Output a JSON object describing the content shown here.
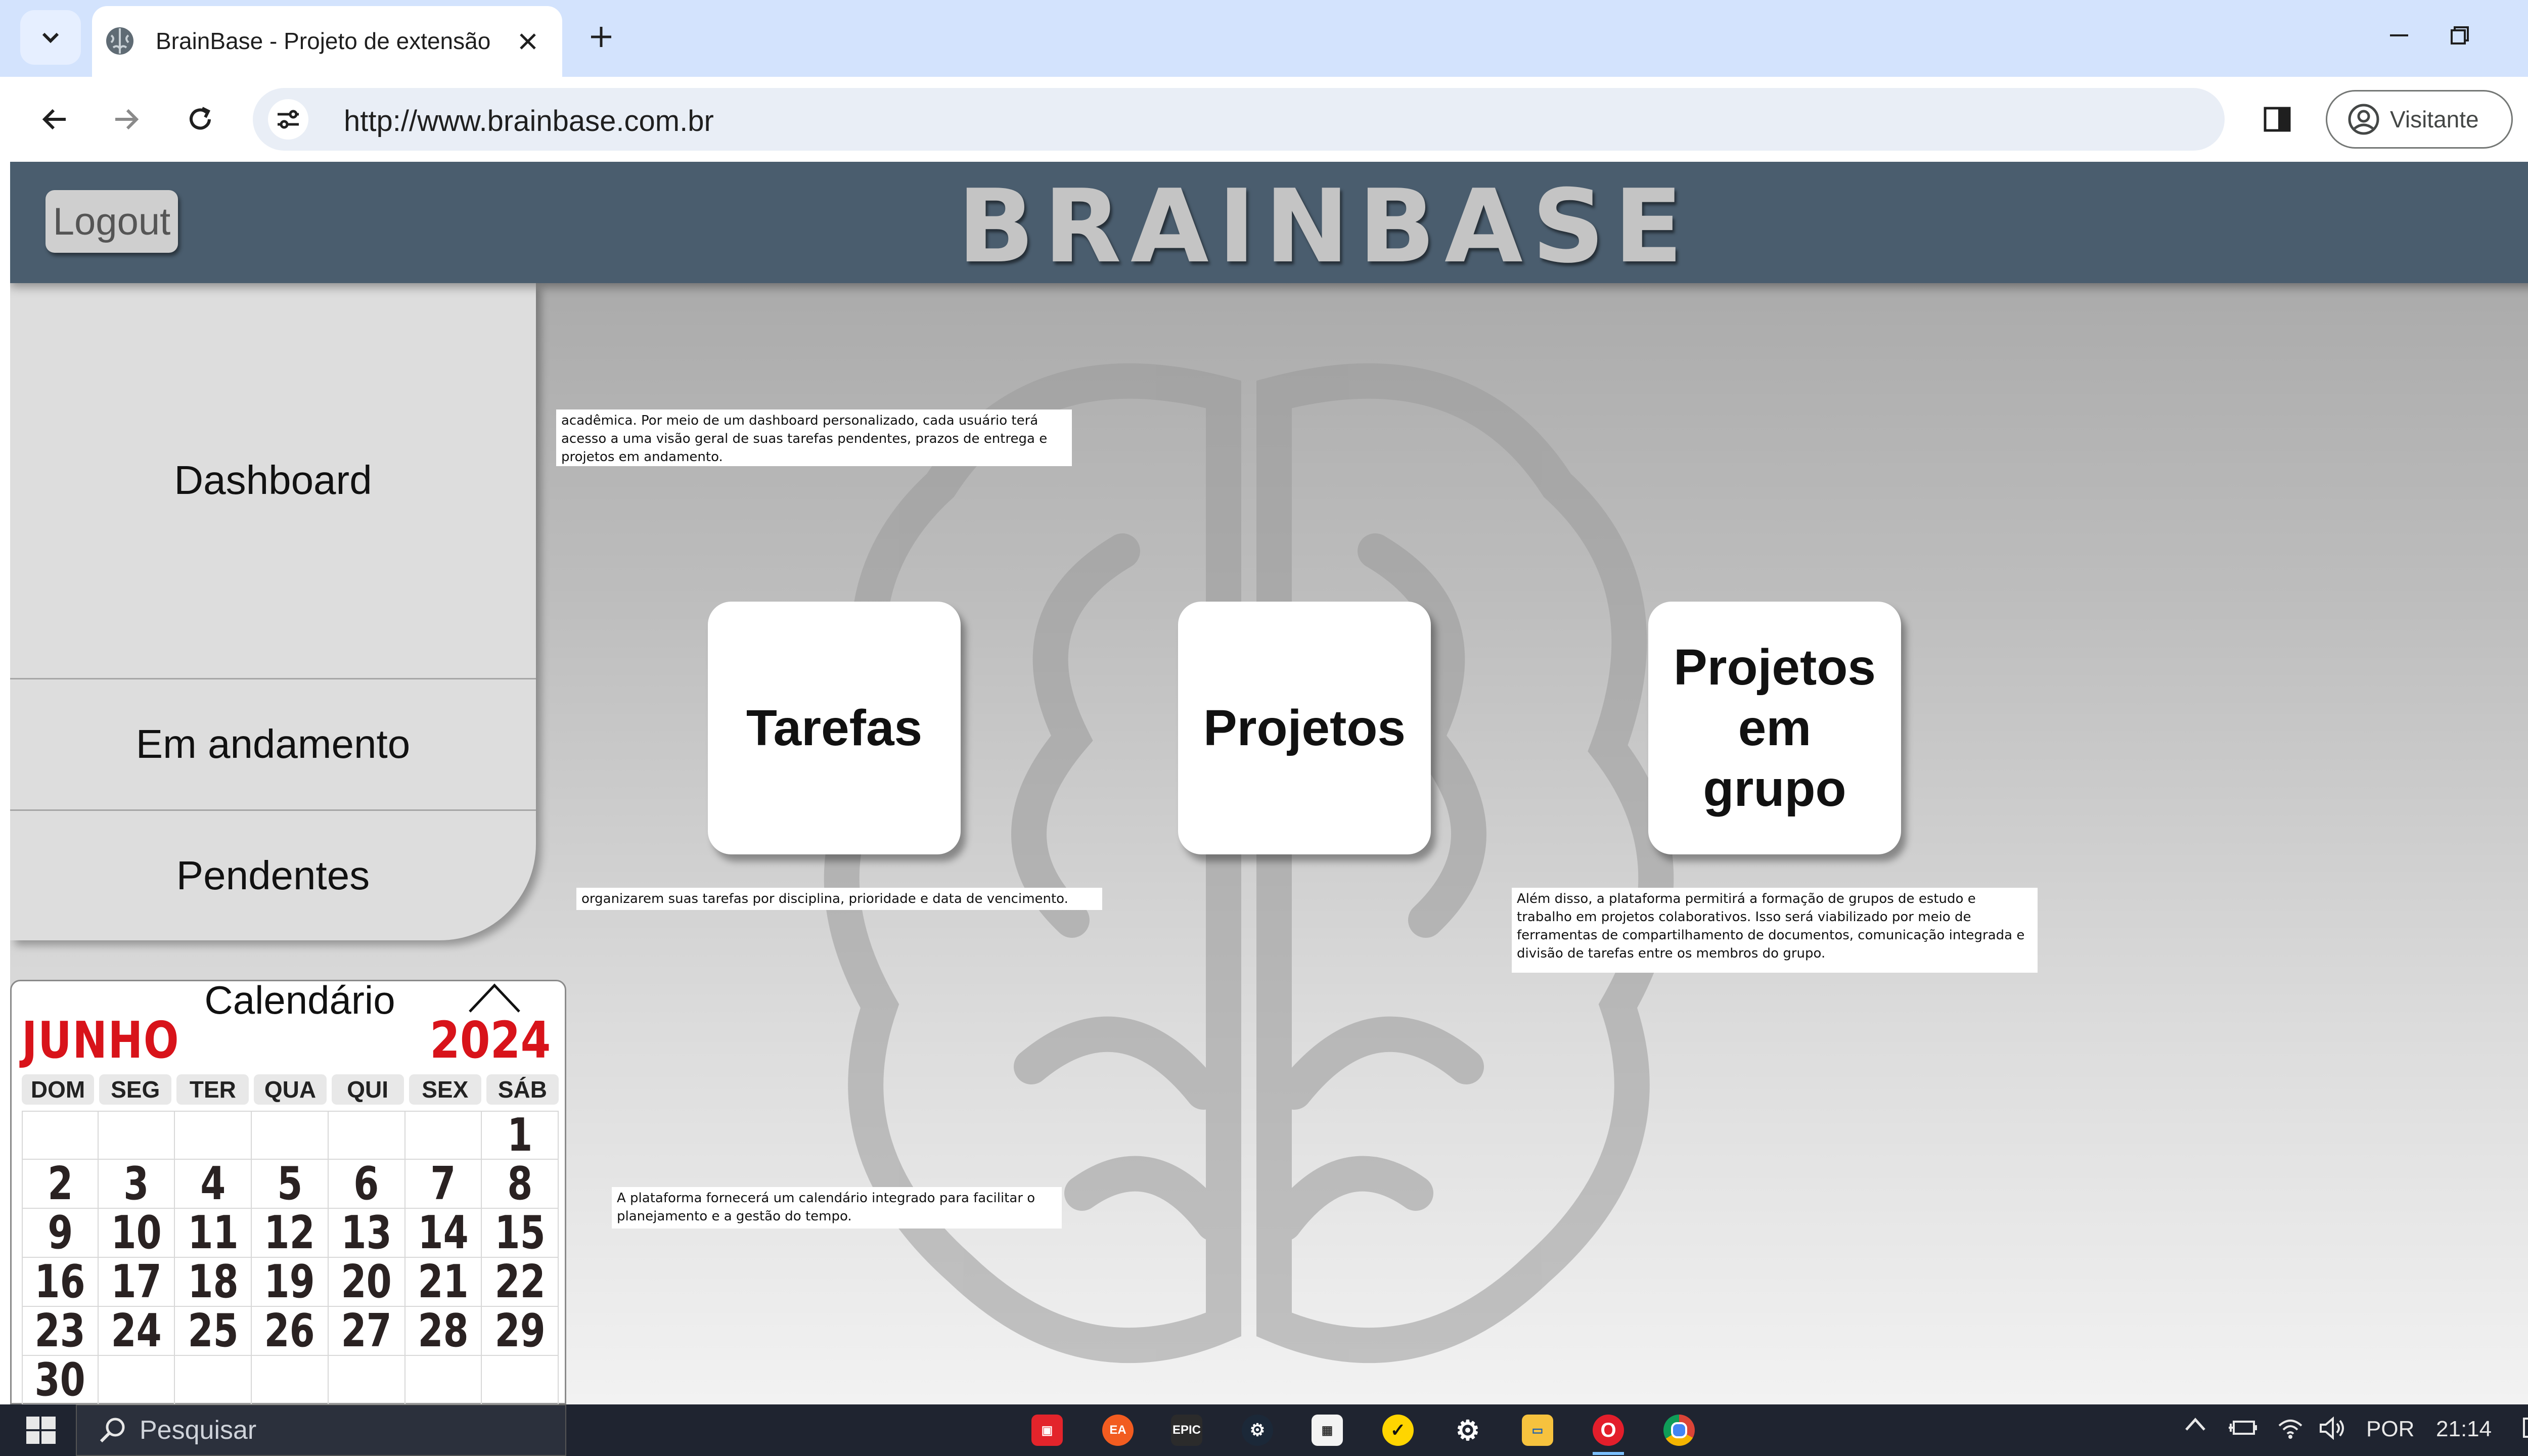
{
  "browser": {
    "tab_title": "BrainBase - Projeto de extensão",
    "url": "http://www.brainbase.com.br",
    "profile_label": "Visitante"
  },
  "header": {
    "logout_label": "Logout",
    "brand": "BRAINBASE"
  },
  "sidebar": {
    "items": [
      {
        "label": "Dashboard"
      },
      {
        "label": "Em andamento"
      },
      {
        "label": "Pendentes"
      }
    ]
  },
  "cards": [
    {
      "label": "Tarefas"
    },
    {
      "label": "Projetos"
    },
    {
      "label": "Projetos em grupo"
    }
  ],
  "notes": {
    "top_left": "acadêmica. Por meio de um dashboard personalizado, cada usuário terá acesso a uma visão geral de suas tarefas pendentes, prazos de entrega e projetos em andamento.",
    "middle_left": "organizarem suas tarefas por disciplina, prioridade e data de vencimento.",
    "right": "Além disso, a plataforma permitirá a formação de grupos de estudo e trabalho em projetos colaborativos. Isso será viabilizado por meio de ferramentas de compartilhamento de documentos, comunicação integrada e divisão de tarefas entre os membros do grupo.",
    "bottom_left": "A plataforma fornecerá um calendário integrado para facilitar o planejamento e a gestão do tempo."
  },
  "calendar": {
    "title": "Calendário",
    "month": "JUNHO",
    "year": "2024",
    "weekdays": [
      "DOM",
      "SEG",
      "TER",
      "QUA",
      "QUI",
      "SEX",
      "SÁB"
    ],
    "weeks": [
      [
        "",
        "",
        "",
        "",
        "",
        "",
        "1"
      ],
      [
        "2",
        "3",
        "4",
        "5",
        "6",
        "7",
        "8"
      ],
      [
        "9",
        "10",
        "11",
        "12",
        "13",
        "14",
        "15"
      ],
      [
        "16",
        "17",
        "18",
        "19",
        "20",
        "21",
        "22"
      ],
      [
        "23",
        "24",
        "25",
        "26",
        "27",
        "28",
        "29"
      ],
      [
        "30",
        "",
        "",
        "",
        "",
        "",
        ""
      ]
    ],
    "accent_color": "#d8131a"
  },
  "taskbar": {
    "search_placeholder": "Pesquisar",
    "tray_language": "POR",
    "tray_time": "21:14",
    "apps": [
      "roblox-icon",
      "ea-icon",
      "epic-games-icon",
      "steam-icon",
      "microsoft-store-icon",
      "norton-icon",
      "settings-gear-icon",
      "file-explorer-icon",
      "opera-gx-icon",
      "chrome-icon"
    ]
  }
}
